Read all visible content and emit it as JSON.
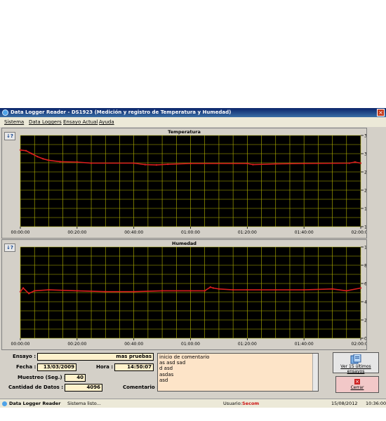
{
  "window": {
    "title": "Data Logger Reader - DS1923 (Medición y registro de Temperatura y Humedad)"
  },
  "menu": [
    "Sistema",
    "Data Loggers",
    "Ensayo Actual",
    "Ayuda"
  ],
  "help_label": "↓?",
  "temperature": {
    "title": "Temperatura",
    "y_ticks": [
      "35,0 ºC",
      "30,0 ºC",
      "25,0 ºC",
      "20,0 ºC",
      "15,0 ºC",
      "10,0 ºC"
    ],
    "x_ticks": [
      "00:00:00",
      "00:20:00",
      "00:40:00",
      "01:00:00",
      "01:20:00",
      "01:40:00",
      "02:00:00"
    ],
    "chart_data": {
      "type": "line",
      "title": "Temperatura",
      "ylim": [
        10,
        35
      ],
      "x": [
        "00:00:00",
        "00:02:00",
        "00:04:00",
        "00:06:00",
        "00:08:00",
        "00:10:00",
        "00:14:00",
        "00:20:00",
        "00:25:00",
        "00:40:00",
        "00:44:00",
        "00:48:00",
        "00:52:00",
        "01:00:00",
        "01:20:00",
        "01:22:00",
        "01:30:00",
        "01:40:00",
        "01:56:00",
        "01:58:00",
        "02:00:00"
      ],
      "values": [
        31.0,
        30.8,
        30.0,
        29.2,
        28.6,
        28.2,
        27.8,
        27.7,
        27.4,
        27.4,
        27.0,
        26.9,
        27.1,
        27.3,
        27.3,
        27.0,
        27.2,
        27.3,
        27.4,
        27.7,
        27.4
      ]
    }
  },
  "humidity": {
    "title": "Humedad",
    "y_ticks": [
      "100,0 %",
      "80,0 %",
      "60,0 %",
      "40,0 %",
      "20,0 %",
      "0,0 %"
    ],
    "x_ticks": [
      "00:00:00",
      "00:20:00",
      "00:40:00",
      "01:00:00",
      "01:20:00",
      "01:40:00",
      "02:00:00"
    ],
    "chart_data": {
      "type": "line",
      "title": "Humedad",
      "ylim": [
        0,
        100
      ],
      "x": [
        "00:00:00",
        "00:01:00",
        "00:03:00",
        "00:05:00",
        "00:10:00",
        "00:20:00",
        "00:30:00",
        "00:40:00",
        "00:50:00",
        "01:00:00",
        "01:05:00",
        "01:07:00",
        "01:08:00",
        "01:10:00",
        "01:15:00",
        "01:20:00",
        "01:30:00",
        "01:40:00",
        "01:50:00",
        "01:55:00",
        "02:00:00"
      ],
      "values": [
        51,
        55,
        49,
        52,
        53,
        52,
        51,
        51,
        52,
        52,
        52,
        56,
        55,
        54,
        53,
        53,
        53,
        53,
        54,
        52,
        55
      ]
    }
  },
  "form": {
    "ensayo_label": "Ensayo :",
    "ensayo_value": "mas pruebas",
    "fecha_label": "Fecha :",
    "fecha_value": "13/03/2009",
    "hora_label": "Hora :",
    "hora_value": "14:50:07",
    "muestreo_label": "Muestreo (Seg.) :",
    "muestreo_value": "40",
    "cantidad_label": "Cantidad de Datos :",
    "cantidad_value": "4096",
    "comentario_label": "Comentario :",
    "comentario_lines": [
      "inicio de comentario",
      "as asd sad",
      "d asd",
      "asdas",
      "asd"
    ]
  },
  "buttons": {
    "ver_label": "Ver 15 últimos ensayos",
    "cerrar_label": "Cerrar"
  },
  "status": {
    "app_name": "Data Logger Reader",
    "message": "Sistema listo...",
    "usuario_label": "Usuario:",
    "usuario_value": "Secom",
    "date": "15/08/2012",
    "time": "10:36:00"
  },
  "colors": {
    "series": "#d81e1e",
    "grid": "#b8b800",
    "plot_bg": "#000000"
  }
}
